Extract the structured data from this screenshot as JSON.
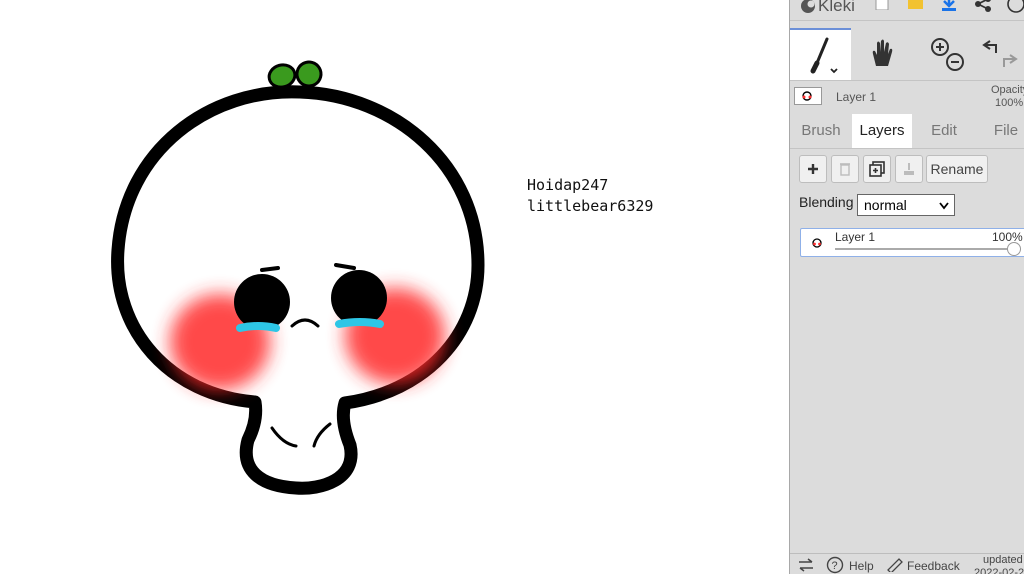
{
  "canvas": {
    "text_line1": "Hoidap247",
    "text_line2": "littlebear6329"
  },
  "topbar": {
    "app_name": "Kleki",
    "icons": [
      "kleki-logo-icon",
      "new-image-icon",
      "open-folder-icon",
      "download-icon",
      "share-icon",
      "help-icon"
    ]
  },
  "tools": {
    "brush": "brush-icon",
    "hand": "hand-icon",
    "zoom_in": "zoom-in-icon",
    "zoom_out": "zoom-out-icon",
    "undo": "undo-icon",
    "redo": "redo-icon"
  },
  "layer_bar": {
    "layer_name": "Layer 1",
    "opacity_label": "Opacity",
    "opacity_value": "100%"
  },
  "tabs": [
    {
      "label": "Brush",
      "active": false
    },
    {
      "label": "Layers",
      "active": true
    },
    {
      "label": "Edit",
      "active": false
    },
    {
      "label": "File",
      "active": false
    }
  ],
  "layers_panel": {
    "rename_label": "Rename",
    "blending_label": "Blending",
    "blending_value": "normal",
    "layer": {
      "name": "Layer 1",
      "opacity": "100%",
      "opacity_fraction": 1.0
    }
  },
  "bottombar": {
    "help_label": "Help",
    "feedback_label": "Feedback",
    "updated_label": "updated",
    "updated_date": "2022-02-2"
  },
  "colors": {
    "panel_bg": "#dcdcdc",
    "accent": "#1a73e8",
    "selection_border": "#8fb0e8",
    "sprout_green": "#3a9a1e",
    "blush_red": "#ff2a2a",
    "tear_cyan": "#2ec6e6"
  }
}
